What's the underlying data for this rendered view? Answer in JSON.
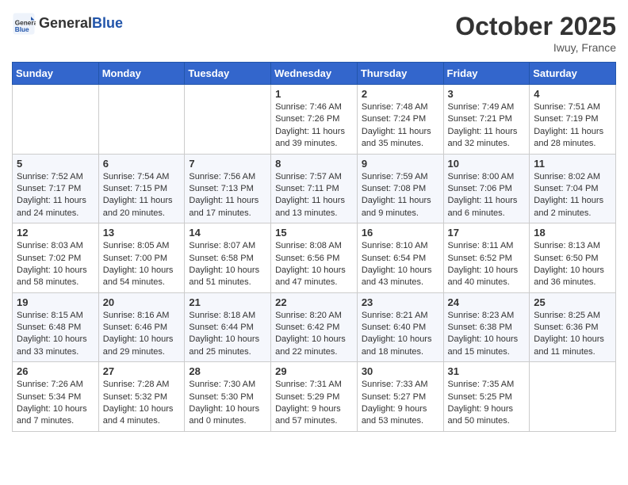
{
  "header": {
    "logo": {
      "general": "General",
      "blue": "Blue"
    },
    "title": "October 2025",
    "location": "Iwuy, France"
  },
  "weekdays": [
    "Sunday",
    "Monday",
    "Tuesday",
    "Wednesday",
    "Thursday",
    "Friday",
    "Saturday"
  ],
  "weeks": [
    [
      {
        "day": "",
        "content": ""
      },
      {
        "day": "",
        "content": ""
      },
      {
        "day": "",
        "content": ""
      },
      {
        "day": "1",
        "content": "Sunrise: 7:46 AM\nSunset: 7:26 PM\nDaylight: 11 hours and 39 minutes."
      },
      {
        "day": "2",
        "content": "Sunrise: 7:48 AM\nSunset: 7:24 PM\nDaylight: 11 hours and 35 minutes."
      },
      {
        "day": "3",
        "content": "Sunrise: 7:49 AM\nSunset: 7:21 PM\nDaylight: 11 hours and 32 minutes."
      },
      {
        "day": "4",
        "content": "Sunrise: 7:51 AM\nSunset: 7:19 PM\nDaylight: 11 hours and 28 minutes."
      }
    ],
    [
      {
        "day": "5",
        "content": "Sunrise: 7:52 AM\nSunset: 7:17 PM\nDaylight: 11 hours and 24 minutes."
      },
      {
        "day": "6",
        "content": "Sunrise: 7:54 AM\nSunset: 7:15 PM\nDaylight: 11 hours and 20 minutes."
      },
      {
        "day": "7",
        "content": "Sunrise: 7:56 AM\nSunset: 7:13 PM\nDaylight: 11 hours and 17 minutes."
      },
      {
        "day": "8",
        "content": "Sunrise: 7:57 AM\nSunset: 7:11 PM\nDaylight: 11 hours and 13 minutes."
      },
      {
        "day": "9",
        "content": "Sunrise: 7:59 AM\nSunset: 7:08 PM\nDaylight: 11 hours and 9 minutes."
      },
      {
        "day": "10",
        "content": "Sunrise: 8:00 AM\nSunset: 7:06 PM\nDaylight: 11 hours and 6 minutes."
      },
      {
        "day": "11",
        "content": "Sunrise: 8:02 AM\nSunset: 7:04 PM\nDaylight: 11 hours and 2 minutes."
      }
    ],
    [
      {
        "day": "12",
        "content": "Sunrise: 8:03 AM\nSunset: 7:02 PM\nDaylight: 10 hours and 58 minutes."
      },
      {
        "day": "13",
        "content": "Sunrise: 8:05 AM\nSunset: 7:00 PM\nDaylight: 10 hours and 54 minutes."
      },
      {
        "day": "14",
        "content": "Sunrise: 8:07 AM\nSunset: 6:58 PM\nDaylight: 10 hours and 51 minutes."
      },
      {
        "day": "15",
        "content": "Sunrise: 8:08 AM\nSunset: 6:56 PM\nDaylight: 10 hours and 47 minutes."
      },
      {
        "day": "16",
        "content": "Sunrise: 8:10 AM\nSunset: 6:54 PM\nDaylight: 10 hours and 43 minutes."
      },
      {
        "day": "17",
        "content": "Sunrise: 8:11 AM\nSunset: 6:52 PM\nDaylight: 10 hours and 40 minutes."
      },
      {
        "day": "18",
        "content": "Sunrise: 8:13 AM\nSunset: 6:50 PM\nDaylight: 10 hours and 36 minutes."
      }
    ],
    [
      {
        "day": "19",
        "content": "Sunrise: 8:15 AM\nSunset: 6:48 PM\nDaylight: 10 hours and 33 minutes."
      },
      {
        "day": "20",
        "content": "Sunrise: 8:16 AM\nSunset: 6:46 PM\nDaylight: 10 hours and 29 minutes."
      },
      {
        "day": "21",
        "content": "Sunrise: 8:18 AM\nSunset: 6:44 PM\nDaylight: 10 hours and 25 minutes."
      },
      {
        "day": "22",
        "content": "Sunrise: 8:20 AM\nSunset: 6:42 PM\nDaylight: 10 hours and 22 minutes."
      },
      {
        "day": "23",
        "content": "Sunrise: 8:21 AM\nSunset: 6:40 PM\nDaylight: 10 hours and 18 minutes."
      },
      {
        "day": "24",
        "content": "Sunrise: 8:23 AM\nSunset: 6:38 PM\nDaylight: 10 hours and 15 minutes."
      },
      {
        "day": "25",
        "content": "Sunrise: 8:25 AM\nSunset: 6:36 PM\nDaylight: 10 hours and 11 minutes."
      }
    ],
    [
      {
        "day": "26",
        "content": "Sunrise: 7:26 AM\nSunset: 5:34 PM\nDaylight: 10 hours and 7 minutes."
      },
      {
        "day": "27",
        "content": "Sunrise: 7:28 AM\nSunset: 5:32 PM\nDaylight: 10 hours and 4 minutes."
      },
      {
        "day": "28",
        "content": "Sunrise: 7:30 AM\nSunset: 5:30 PM\nDaylight: 10 hours and 0 minutes."
      },
      {
        "day": "29",
        "content": "Sunrise: 7:31 AM\nSunset: 5:29 PM\nDaylight: 9 hours and 57 minutes."
      },
      {
        "day": "30",
        "content": "Sunrise: 7:33 AM\nSunset: 5:27 PM\nDaylight: 9 hours and 53 minutes."
      },
      {
        "day": "31",
        "content": "Sunrise: 7:35 AM\nSunset: 5:25 PM\nDaylight: 9 hours and 50 minutes."
      },
      {
        "day": "",
        "content": ""
      }
    ]
  ]
}
